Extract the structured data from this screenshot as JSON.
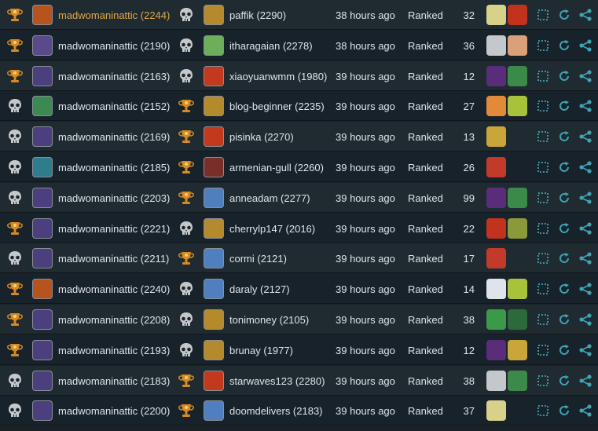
{
  "colors": {
    "row_odd": "#1f2a31",
    "row_even": "#18222a",
    "text": "#dfe5ea",
    "highlight_name": "#e0a84a",
    "action_icons": "#3fa3b3",
    "trophy": "#d78a22",
    "skull": "#c5c8cb"
  },
  "battles": [
    {
      "p1_result": "trophy-icon",
      "p1_name": "madwomaninattic (2244)",
      "p1_highlight": true,
      "p1_avatar": "#b7531c",
      "p2_result": "skull-icon",
      "p2_name": "paffik (2290)",
      "p2_avatar": "#b58a2c",
      "time": "38 hours ago",
      "mode": "Ranked",
      "count": "32",
      "cards": [
        "#d8d18a",
        "#c2321d"
      ]
    },
    {
      "p1_result": "trophy-icon",
      "p1_name": "madwomaninattic (2190)",
      "p1_highlight": false,
      "p1_avatar": "#5b4a8a",
      "p2_result": "skull-icon",
      "p2_name": "itharagaian (2278)",
      "p2_avatar": "#6cae59",
      "time": "38 hours ago",
      "mode": "Ranked",
      "count": "36",
      "cards": [
        "#c4c8cc",
        "#dba078"
      ]
    },
    {
      "p1_result": "trophy-icon",
      "p1_name": "madwomaninattic (2163)",
      "p1_highlight": false,
      "p1_avatar": "#4c3f7e",
      "p2_result": "skull-icon",
      "p2_name": "xiaoyuanwmm (1980)",
      "p2_avatar": "#c2391e",
      "time": "39 hours ago",
      "mode": "Ranked",
      "count": "12",
      "cards": [
        "#5a2d7a",
        "#3c8a4a"
      ]
    },
    {
      "p1_result": "skull-icon",
      "p1_name": "madwomaninattic (2152)",
      "p1_highlight": false,
      "p1_avatar": "#3a8a52",
      "p2_result": "trophy-icon",
      "p2_name": "blog-beginner (2235)",
      "p2_avatar": "#b58a2c",
      "time": "39 hours ago",
      "mode": "Ranked",
      "count": "27",
      "cards": [
        "#e08a3a",
        "#a8c23a"
      ]
    },
    {
      "p1_result": "skull-icon",
      "p1_name": "madwomaninattic (2169)",
      "p1_highlight": false,
      "p1_avatar": "#4c3f7e",
      "p2_result": "trophy-icon",
      "p2_name": "pisinka (2270)",
      "p2_avatar": "#c2391e",
      "time": "39 hours ago",
      "mode": "Ranked",
      "count": "13",
      "cards": [
        "#c9a53a"
      ]
    },
    {
      "p1_result": "skull-icon",
      "p1_name": "madwomaninattic (2185)",
      "p1_highlight": false,
      "p1_avatar": "#2f7c8c",
      "p2_result": "trophy-icon",
      "p2_name": "armenian-gull (2260)",
      "p2_avatar": "#7a2e2a",
      "time": "39 hours ago",
      "mode": "Ranked",
      "count": "26",
      "cards": [
        "#c23a2a"
      ]
    },
    {
      "p1_result": "skull-icon",
      "p1_name": "madwomaninattic (2203)",
      "p1_highlight": false,
      "p1_avatar": "#4c3f7e",
      "p2_result": "trophy-icon",
      "p2_name": "anneadam (2277)",
      "p2_avatar": "#4f7fbf",
      "time": "39 hours ago",
      "mode": "Ranked",
      "count": "99",
      "cards": [
        "#5a2d7a",
        "#3c8a4a"
      ]
    },
    {
      "p1_result": "trophy-icon",
      "p1_name": "madwomaninattic (2221)",
      "p1_highlight": false,
      "p1_avatar": "#4c3f7e",
      "p2_result": "skull-icon",
      "p2_name": "cherrylp147 (2016)",
      "p2_avatar": "#b58a2c",
      "time": "39 hours ago",
      "mode": "Ranked",
      "count": "22",
      "cards": [
        "#c2321d",
        "#8a9a3a"
      ]
    },
    {
      "p1_result": "skull-icon",
      "p1_name": "madwomaninattic (2211)",
      "p1_highlight": false,
      "p1_avatar": "#4c3f7e",
      "p2_result": "trophy-icon",
      "p2_name": "cormi (2121)",
      "p2_avatar": "#4f7fbf",
      "time": "39 hours ago",
      "mode": "Ranked",
      "count": "17",
      "cards": [
        "#c23a2a"
      ]
    },
    {
      "p1_result": "trophy-icon",
      "p1_name": "madwomaninattic (2240)",
      "p1_highlight": false,
      "p1_avatar": "#b7531c",
      "p2_result": "skull-icon",
      "p2_name": "daraly (2127)",
      "p2_avatar": "#4f7fbf",
      "time": "39 hours ago",
      "mode": "Ranked",
      "count": "14",
      "cards": [
        "#dfe4ea",
        "#a8c23a"
      ]
    },
    {
      "p1_result": "trophy-icon",
      "p1_name": "madwomaninattic (2208)",
      "p1_highlight": false,
      "p1_avatar": "#4c3f7e",
      "p2_result": "skull-icon",
      "p2_name": "tonimoney (2105)",
      "p2_avatar": "#b58a2c",
      "time": "39 hours ago",
      "mode": "Ranked",
      "count": "38",
      "cards": [
        "#3a9a4a",
        "#2c6a3a"
      ]
    },
    {
      "p1_result": "trophy-icon",
      "p1_name": "madwomaninattic (2193)",
      "p1_highlight": false,
      "p1_avatar": "#4c3f7e",
      "p2_result": "skull-icon",
      "p2_name": "brunay (1977)",
      "p2_avatar": "#b58a2c",
      "time": "39 hours ago",
      "mode": "Ranked",
      "count": "12",
      "cards": [
        "#5a2d7a",
        "#c9a53a"
      ]
    },
    {
      "p1_result": "skull-icon",
      "p1_name": "madwomaninattic (2183)",
      "p1_highlight": false,
      "p1_avatar": "#4c3f7e",
      "p2_result": "trophy-icon",
      "p2_name": "starwaves123 (2280)",
      "p2_avatar": "#c2391e",
      "time": "39 hours ago",
      "mode": "Ranked",
      "count": "38",
      "cards": [
        "#c4c8cc",
        "#3c8a4a"
      ]
    },
    {
      "p1_result": "skull-icon",
      "p1_name": "madwomaninattic (2200)",
      "p1_highlight": false,
      "p1_avatar": "#4c3f7e",
      "p2_result": "trophy-icon",
      "p2_name": "doomdelivers (2183)",
      "p2_avatar": "#4f7fbf",
      "time": "39 hours ago",
      "mode": "Ranked",
      "count": "37",
      "cards": [
        "#d8d18a"
      ]
    }
  ]
}
